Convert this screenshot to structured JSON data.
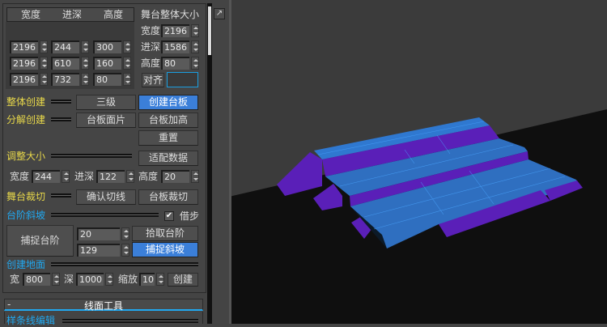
{
  "table": {
    "headers": [
      "宽度",
      "进深",
      "高度"
    ],
    "rows": [
      [
        "2196",
        "244",
        "300"
      ],
      [
        "2196",
        "610",
        "160"
      ],
      [
        "2196",
        "732",
        "80"
      ]
    ]
  },
  "stage": {
    "title": "舞台整体大小",
    "width_label": "宽度",
    "width": "2196",
    "depth_label": "进深",
    "depth": "1586",
    "height_label": "高度",
    "height": "80",
    "align_label": "对齐",
    "align_color": "#1a9ee0"
  },
  "create": {
    "whole_label": "整体创建",
    "level_btn": "三级",
    "create_board_btn": "创建台板",
    "split_label": "分解创建",
    "board_face_btn": "台板面片",
    "board_raise_btn": "台板加高",
    "reset_btn": "重置"
  },
  "resize": {
    "label": "调整大小",
    "fit_btn": "适配数据",
    "w_label": "宽度",
    "w": "244",
    "d_label": "进深",
    "d": "122",
    "h_label": "高度",
    "h": "20"
  },
  "cut": {
    "label": "舞台裁切",
    "confirm_btn": "确认切线",
    "board_cut_btn": "台板裁切"
  },
  "steps": {
    "label": "台阶斜坡",
    "borrow_label": "借步",
    "borrow_checked": true,
    "capture_step_btn": "捕捉台阶",
    "v1": "20",
    "v2": "129",
    "pick_step_btn": "拾取台阶",
    "capture_slope_btn": "捕捉斜坡"
  },
  "ground": {
    "label": "创建地面",
    "w_label": "宽",
    "w": "800",
    "d_label": "深",
    "d": "1000",
    "scale_label": "缩放",
    "scale": "10",
    "create_btn": "创建"
  },
  "rollout": {
    "toggle": "-",
    "title": "线面工具",
    "spline_label": "样条线编辑"
  },
  "colors": {
    "accent": "#3b7fd9",
    "yellow": "#e8d84a",
    "blue_label": "#21a8f0",
    "mesh_blue": "#2f6fc0",
    "mesh_purple": "#5a1fb8"
  }
}
